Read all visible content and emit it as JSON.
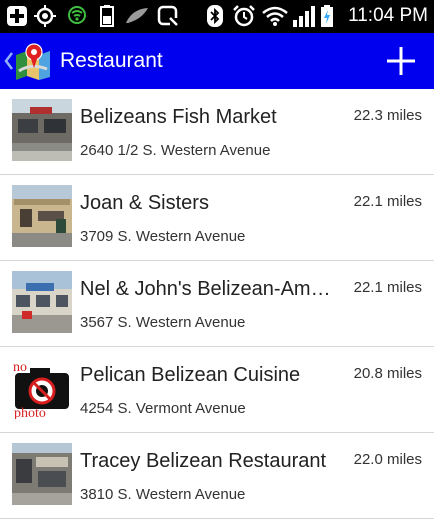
{
  "status_bar": {
    "time": "11:04 PM",
    "icons": [
      "add-icon",
      "location-target-icon",
      "usb-icon",
      "battery-small-icon",
      "feather-icon",
      "screenshot-icon",
      "bluetooth-icon",
      "alarm-icon",
      "wifi-icon",
      "signal-icon",
      "battery-charging-icon"
    ]
  },
  "action_bar": {
    "title": "Restaurant",
    "app_icon": "map-pin-icon",
    "add_icon": "plus-icon",
    "color": "#0000ee"
  },
  "restaurants": [
    {
      "name": "Belizeans Fish Market",
      "address": "2640 1/2 S. Western Avenue",
      "distance": "22.3 miles",
      "thumbnail": "storefront-photo"
    },
    {
      "name": "Joan & Sisters",
      "address": "3709 S. Western Avenue",
      "distance": "22.1 miles",
      "thumbnail": "storefront-photo"
    },
    {
      "name": "Nel & John's Belizean-American Restaurant",
      "address": "3567 S. Western Avenue",
      "distance": "22.1 miles",
      "thumbnail": "storefront-photo"
    },
    {
      "name": "Pelican Belizean Cuisine",
      "address": "4254 S. Vermont Avenue",
      "distance": "20.8 miles",
      "thumbnail": "no-photo",
      "thumbnail_text_top": "no",
      "thumbnail_text_bottom": "photo"
    },
    {
      "name": "Tracey Belizean Restaurant",
      "address": "3810 S. Western Avenue",
      "distance": "22.0 miles",
      "thumbnail": "storefront-photo"
    }
  ]
}
